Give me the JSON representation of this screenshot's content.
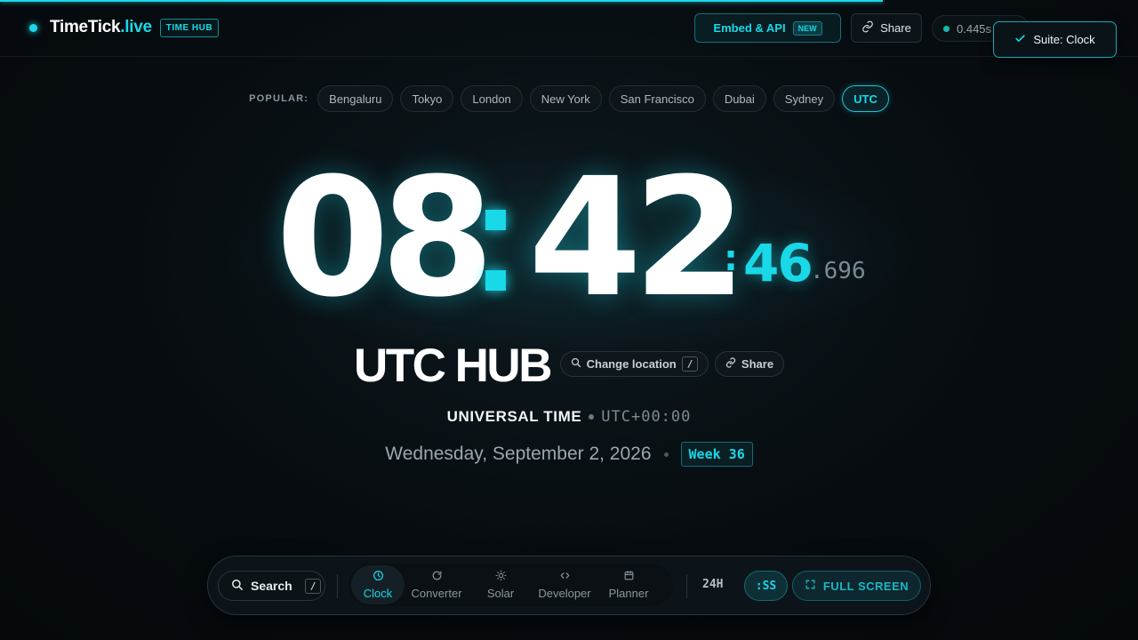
{
  "theme": {
    "accent": "#19d8e8",
    "background": "#070c10"
  },
  "header": {
    "brand_name": "TimeTick",
    "brand_tld": ".live",
    "brand_badge": "TIME HUB",
    "embed_label": "Embed & API",
    "embed_tag": "NEW",
    "share_label": "Share",
    "latency": "0.445s",
    "page_progress": 0.776
  },
  "toast": {
    "label": "Suite: Clock",
    "icon": "check-icon"
  },
  "popular": {
    "label": "POPULAR:",
    "cities": [
      "Bengaluru",
      "Tokyo",
      "London",
      "New York",
      "San Francisco",
      "Dubai",
      "Sydney",
      "UTC"
    ],
    "active": "UTC"
  },
  "clock": {
    "hours": "08",
    "minutes": "42",
    "sec_colon": ":",
    "seconds": "46",
    "millis": ".696"
  },
  "location": {
    "title": "UTC HUB",
    "change_label": "Change location",
    "change_kbd": "/",
    "share_label": "Share",
    "tz_name": "UNIVERSAL TIME",
    "tz_offset": "UTC+00:00",
    "date": "Wednesday, September 2, 2026",
    "week": "Week 36"
  },
  "dock": {
    "search_label": "Search",
    "search_kbd": "/",
    "nav": [
      {
        "label": "Clock",
        "icon": "clock-icon"
      },
      {
        "label": "Converter",
        "icon": "refresh-icon"
      },
      {
        "label": "Solar",
        "icon": "sun-icon"
      },
      {
        "label": "Developer",
        "icon": "code-icon"
      },
      {
        "label": "Planner",
        "icon": "calendar-icon"
      }
    ],
    "active": "Clock",
    "format_label": "24H",
    "seconds_label": ":SS",
    "fullscreen_label": "FULL SCREEN"
  }
}
